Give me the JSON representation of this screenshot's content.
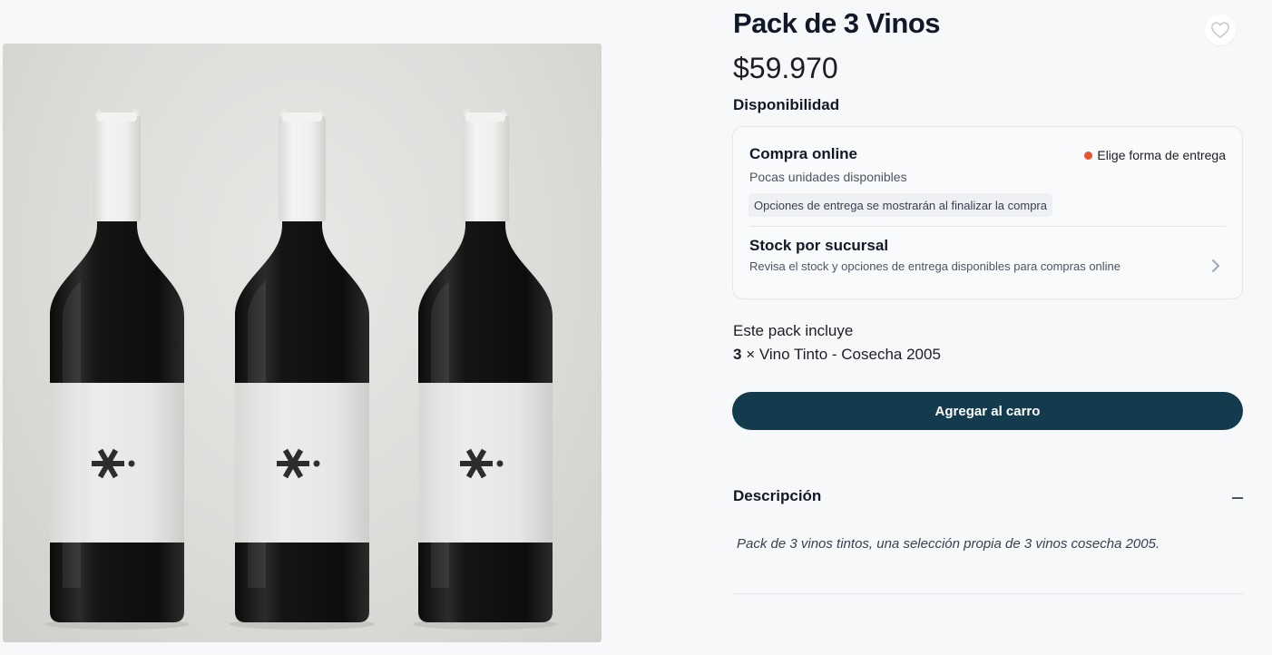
{
  "product": {
    "title": "Pack de 3 Vinos",
    "price": "$59.970",
    "image_alt": "Tres botellas de vino tinto con etiqueta blanca"
  },
  "availability": {
    "section_title": "Disponibilidad",
    "online": {
      "title": "Compra online",
      "subtitle": "Pocas unidades disponibles",
      "status": "Elige forma de entrega",
      "status_color": "#e8542e",
      "note": "Opciones de entrega se mostrarán al finalizar la compra"
    },
    "store_stock": {
      "title": "Stock por sucursal",
      "subtitle": "Revisa el stock y opciones de entrega disponibles para compras online"
    }
  },
  "pack": {
    "heading": "Este pack incluye",
    "items": [
      {
        "qty": "3",
        "label": "× Vino Tinto - Cosecha 2005"
      }
    ]
  },
  "cart": {
    "button_label": "Agregar al carro",
    "button_color": "#143a4d"
  },
  "description": {
    "title": "Descripción",
    "body": "Pack de 3 vinos tintos, una selección propia de 3 vinos cosecha 2005."
  },
  "icons": {
    "favorite": "heart-outline-icon",
    "stock_chevron": "chevron-right-icon",
    "collapse": "minus-icon"
  }
}
